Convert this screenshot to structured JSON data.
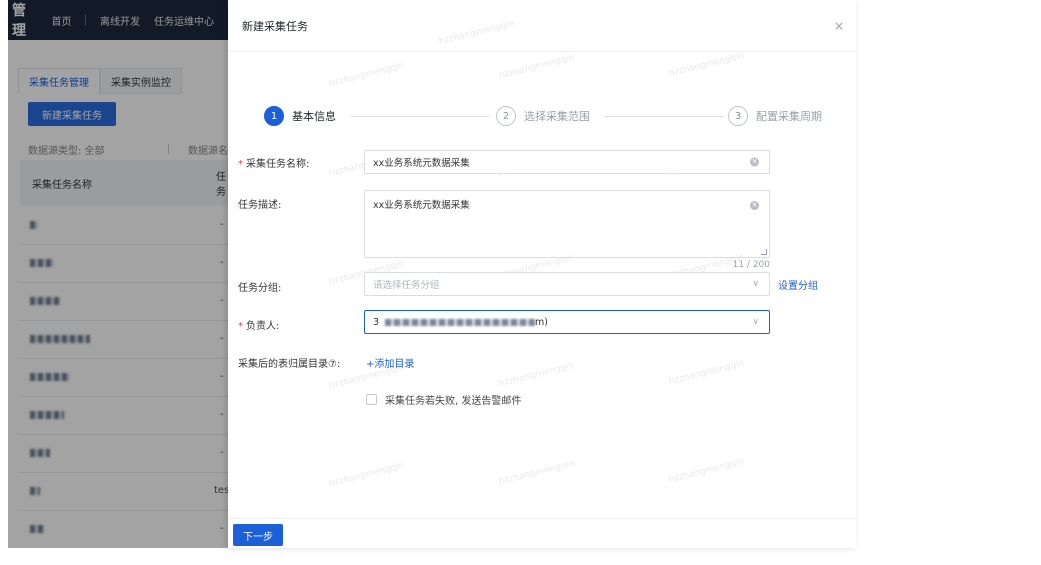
{
  "bg_app": {
    "brand": "管理",
    "nav": [
      "首页",
      "离线开发",
      "任务运维中心"
    ],
    "tabs": [
      "采集任务管理",
      "采集实例监控"
    ],
    "new_button": "新建采集任务",
    "filter_type": "数据源类型: 全部",
    "filter_source": "数据源名",
    "table_headers": [
      "采集任务名称",
      "任务"
    ],
    "row_values": [
      "-",
      "-",
      "-",
      "-",
      "-",
      "-",
      "-",
      "tes",
      "-"
    ]
  },
  "drawer": {
    "title": "新建采集任务",
    "close_symbol": "×",
    "steps": [
      {
        "num": "1",
        "label": "基本信息"
      },
      {
        "num": "2",
        "label": "选择采集范围"
      },
      {
        "num": "3",
        "label": "配置采集周期"
      }
    ],
    "form": {
      "name_label": "采集任务名称:",
      "name_value": "xx业务系统元数据采集",
      "desc_label": "任务描述:",
      "desc_value": "xx业务系统元数据采集",
      "desc_counter": "11 / 200",
      "group_label": "任务分组:",
      "group_placeholder": "请选择任务分组",
      "group_link": "设置分组",
      "owner_label": "负责人:",
      "owner_value_prefix": "3",
      "owner_value_suffix": "m)",
      "catalog_label": "采集后的表归属目录⑦:",
      "catalog_link": "+添加目录",
      "alert_checkbox_label": "采集任务若失败, 发送告警邮件"
    },
    "required_mark": "*",
    "next_button": "下一步"
  },
  "watermark_text": "hzzhangmengqin"
}
